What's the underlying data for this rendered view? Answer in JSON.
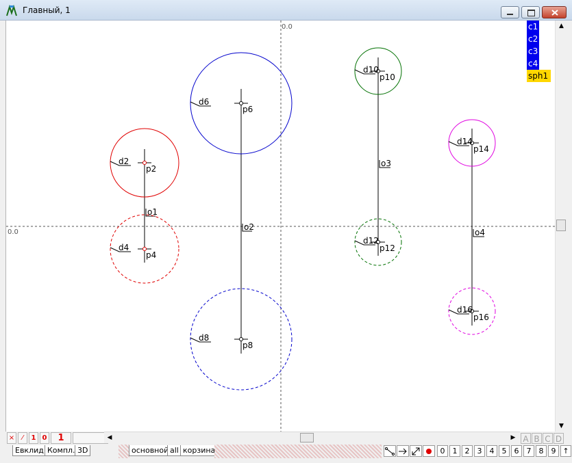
{
  "window": {
    "title": "Главный, 1"
  },
  "axes": {
    "x_origin_label": "0.0",
    "y_origin_label": "0.0"
  },
  "legend": [
    {
      "label": "c1",
      "bg": "#0000ee",
      "fg": "#ffffff"
    },
    {
      "label": "c2",
      "bg": "#0000ee",
      "fg": "#ffffff"
    },
    {
      "label": "c3",
      "bg": "#0000ee",
      "fg": "#ffffff"
    },
    {
      "label": "c4",
      "bg": "#0000ee",
      "fg": "#ffffff"
    },
    {
      "label": "sph1",
      "bg": "#ffd700",
      "fg": "#000000"
    }
  ],
  "drawing": {
    "circles": [
      {
        "d": "d2",
        "p": "p2",
        "color": "#e00000",
        "dashed": false
      },
      {
        "d": "d4",
        "p": "p4",
        "color": "#e00000",
        "dashed": true
      },
      {
        "d": "d6",
        "p": "p6",
        "color": "#0000cc",
        "dashed": false
      },
      {
        "d": "d8",
        "p": "p8",
        "color": "#0000cc",
        "dashed": true
      },
      {
        "d": "d10",
        "p": "p10",
        "color": "#007000",
        "dashed": false
      },
      {
        "d": "d12",
        "p": "p12",
        "color": "#007000",
        "dashed": true
      },
      {
        "d": "d14",
        "p": "p14",
        "color": "#e000e0",
        "dashed": false
      },
      {
        "d": "d16",
        "p": "p16",
        "color": "#e000e0",
        "dashed": true
      }
    ],
    "axis_labels": [
      "o1",
      "o2",
      "o3",
      "o4"
    ]
  },
  "toolbar": {
    "delete_label": "×",
    "line_label": "⁄",
    "one_label": "1",
    "zero_label": "0",
    "level_label": "1"
  },
  "scroll_letters": [
    "A",
    "B",
    "C",
    "D"
  ],
  "tabs": {
    "left": [
      "Евклид",
      "Компл.",
      "3D"
    ],
    "layers": [
      "основной",
      "all",
      "корзина"
    ]
  },
  "tools": {
    "segment_icon": "segment-icon",
    "arrow_icon": "arrow-right-icon",
    "diag_arrow_icon": "diagonal-arrow-icon",
    "record_icon": "record-dot-icon"
  },
  "digit_buttons": [
    "0",
    "1",
    "2",
    "3",
    "4",
    "5",
    "6",
    "7",
    "8",
    "9",
    "↑"
  ]
}
